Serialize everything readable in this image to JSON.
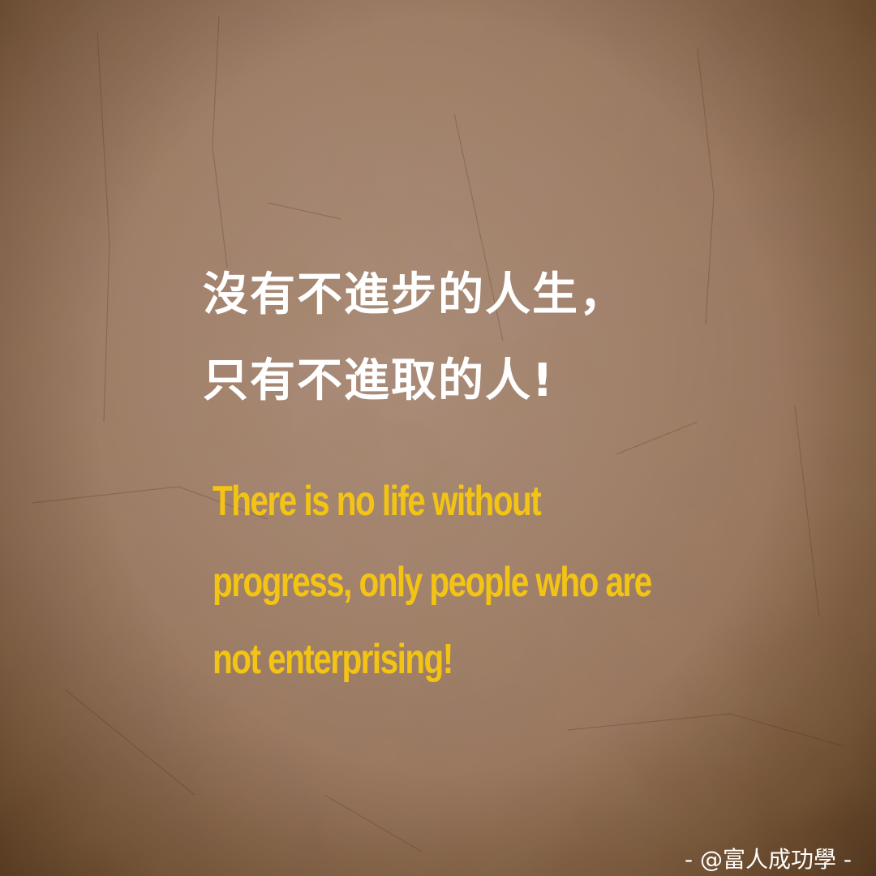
{
  "quote": {
    "chinese_lines": [
      "沒有不進步的人生，",
      "只有不進取的人!"
    ],
    "english_lines": [
      "There is no life without",
      "progress, only people who are",
      "not enterprising!"
    ]
  },
  "watermark": "- @富人成功學 -",
  "colors": {
    "background": "#a3826f",
    "chinese_text": "#ffffff",
    "english_text": "#f3c414"
  }
}
